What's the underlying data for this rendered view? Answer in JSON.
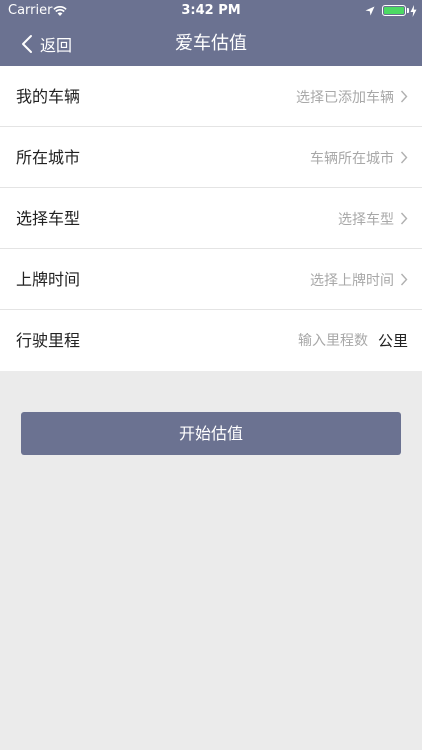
{
  "status_bar": {
    "carrier": "Carrier",
    "time": "3:42 PM",
    "battery_color": "#4cd964"
  },
  "nav": {
    "back_label": "返回",
    "title": "爱车估值"
  },
  "form": {
    "rows": [
      {
        "label": "我的车辆",
        "value": "选择已添加车辆"
      },
      {
        "label": "所在城市",
        "value": "车辆所在城市"
      },
      {
        "label": "选择车型",
        "value": "选择车型"
      },
      {
        "label": "上牌时间",
        "value": "选择上牌时间"
      },
      {
        "label": "行驶里程",
        "placeholder": "输入里程数",
        "unit": "公里"
      }
    ]
  },
  "actions": {
    "start_label": "开始估值"
  },
  "colors": {
    "brand": "#6b7291",
    "background": "#ebebeb"
  }
}
